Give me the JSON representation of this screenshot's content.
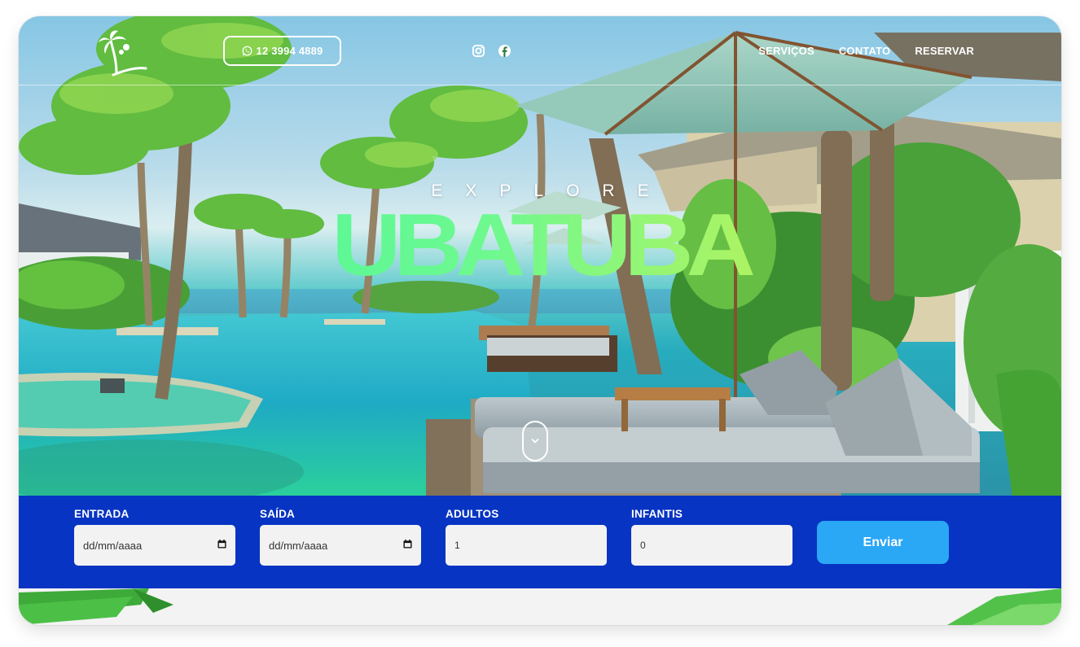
{
  "nav": {
    "phone": "12 3994 4889",
    "social_icons": [
      "instagram-icon",
      "facebook-icon"
    ],
    "menu": [
      "SERVIÇOS",
      "CONTATO",
      "RESERVAR"
    ]
  },
  "hero": {
    "eyebrow": "EXPLORE",
    "title": "UBATUBA"
  },
  "booking": {
    "fields": [
      {
        "label": "ENTRADA",
        "value": "dd/mm/aaaa"
      },
      {
        "label": "SAÍDA",
        "value": "dd/mm/aaaa"
      },
      {
        "label": "ADULTOS",
        "value": "1"
      },
      {
        "label": "INFANTIS",
        "value": "0"
      }
    ],
    "submit_label": "Enviar"
  },
  "colors": {
    "booking_bar": "#0734c2",
    "submit_button": "#2aa7f5",
    "title_gradient_start": "#3df5a0",
    "title_gradient_end": "#d9ef3f"
  }
}
